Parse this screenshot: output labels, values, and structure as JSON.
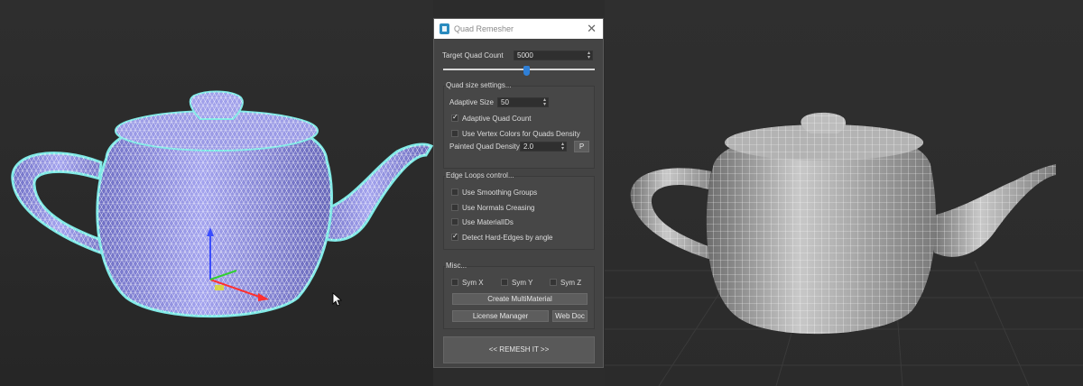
{
  "dialog": {
    "title": "Quad Remesher",
    "close_glyph": "✕",
    "target_quad_count_label": "Target Quad Count",
    "target_quad_count_value": "5000",
    "target_quad_count_slider_fraction": 0.55,
    "quad_size": {
      "title": "Quad size settings...",
      "adaptive_size_label": "Adaptive Size",
      "adaptive_size_value": "50",
      "adaptive_quad_count_label": "Adaptive Quad Count",
      "adaptive_quad_count_checked": true,
      "vertex_colors_label": "Use Vertex Colors for Quads Density",
      "vertex_colors_checked": false,
      "painted_density_label": "Painted Quad Density",
      "painted_density_value": "2.0",
      "p_button_label": "P"
    },
    "edge_loops": {
      "title": "Edge Loops control...",
      "smoothing_groups_label": "Use Smoothing Groups",
      "smoothing_groups_checked": false,
      "normals_creasing_label": "Use Normals Creasing",
      "normals_creasing_checked": false,
      "material_ids_label": "Use MaterialIDs",
      "material_ids_checked": false,
      "hard_edges_label": "Detect Hard-Edges by angle",
      "hard_edges_checked": true
    },
    "misc": {
      "title": "Misc...",
      "sym_x_label": "Sym X",
      "sym_y_label": "Sym Y",
      "sym_z_label": "Sym Z",
      "create_multimaterial_label": "Create MultiMaterial",
      "license_manager_label": "License Manager",
      "web_doc_label": "Web Doc"
    },
    "remesh_button_label": "<<   REMESH IT   >>"
  },
  "colors": {
    "dialog_bg": "#444444",
    "accent_blue": "#2f7fd6",
    "teapot_left_fill": "#8e8ee0",
    "teapot_left_outline": "#7fe9e6",
    "teapot_right_fill": "#b9b9b9",
    "viewport_bg": "#2b2b2b"
  }
}
